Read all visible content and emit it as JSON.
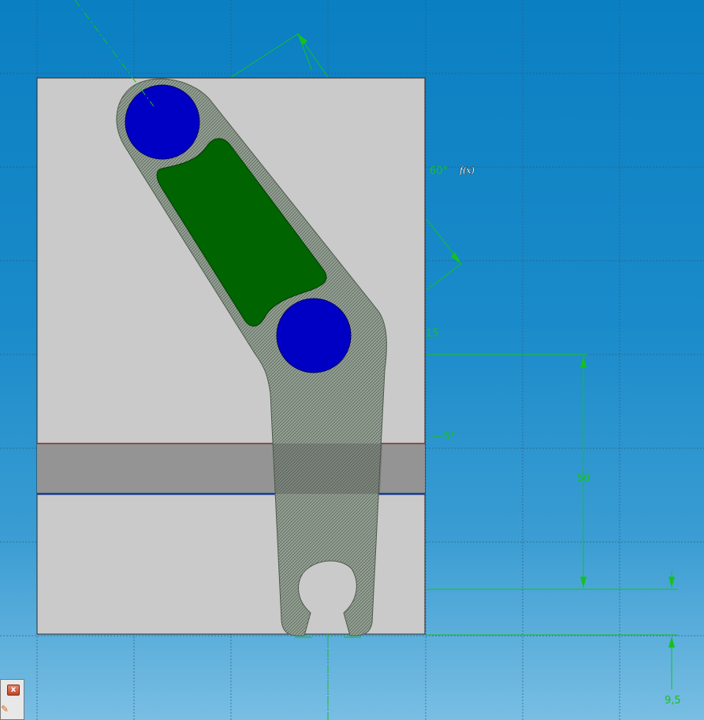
{
  "dimensions": {
    "angle_top": "60°",
    "angle_mid": "15",
    "angle_small": "5°",
    "length_vertical": "50",
    "length_bottom": "9,5"
  },
  "cursor_label": "f(x)",
  "mini_panel": {
    "close_label": "x"
  },
  "colors": {
    "background_top": "#0a7fc2",
    "sheet": "#cacaca",
    "band": "#9a9a9a",
    "part": "#8a9a8a",
    "pocket": "#006400",
    "hole": "#0000c0",
    "dimension": "#14c21e"
  }
}
